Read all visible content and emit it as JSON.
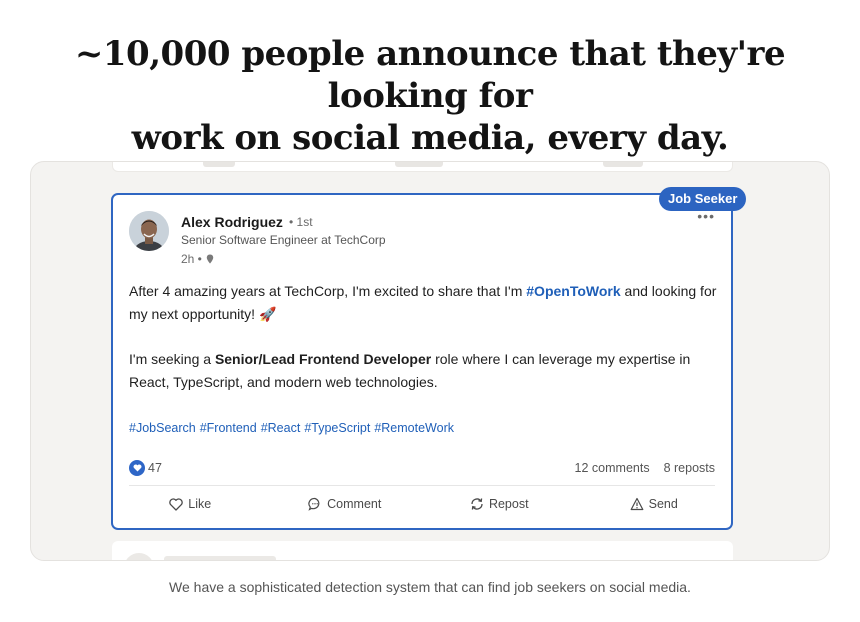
{
  "headline": {
    "line1": "~10,000 people announce that they're looking for",
    "line2": "work on social media, every day."
  },
  "post": {
    "badge": "Job Seeker",
    "author": {
      "name": "Alex Rodriguez",
      "degree": "• 1st",
      "title": "Senior Software Engineer at TechCorp",
      "time": "2h •"
    },
    "body": {
      "p1_before": "After 4 amazing years at TechCorp, I'm excited to share that I'm ",
      "p1_hashtag": "#OpenToWork",
      "p1_after": " and looking for my next opportunity! 🚀",
      "p2_before": "I'm seeking a ",
      "p2_strong": "Senior/Lead Frontend Developer",
      "p2_after": " role where I can leverage my expertise in React, TypeScript, and modern web technologies."
    },
    "hashtags": [
      "#JobSearch",
      "#Frontend",
      "#React",
      "#TypeScript",
      "#RemoteWork"
    ],
    "stats": {
      "reactions": "47",
      "comments": "12 comments",
      "reposts": "8 reposts"
    },
    "actions": {
      "like": "Like",
      "comment": "Comment",
      "repost": "Repost",
      "send": "Send"
    }
  },
  "caption": "We have a sophisticated detection system that can find job seekers on social media.",
  "colors": {
    "accent": "#2f66c2",
    "link": "#1f5fb8",
    "stage_bg": "#f4f3f1"
  }
}
